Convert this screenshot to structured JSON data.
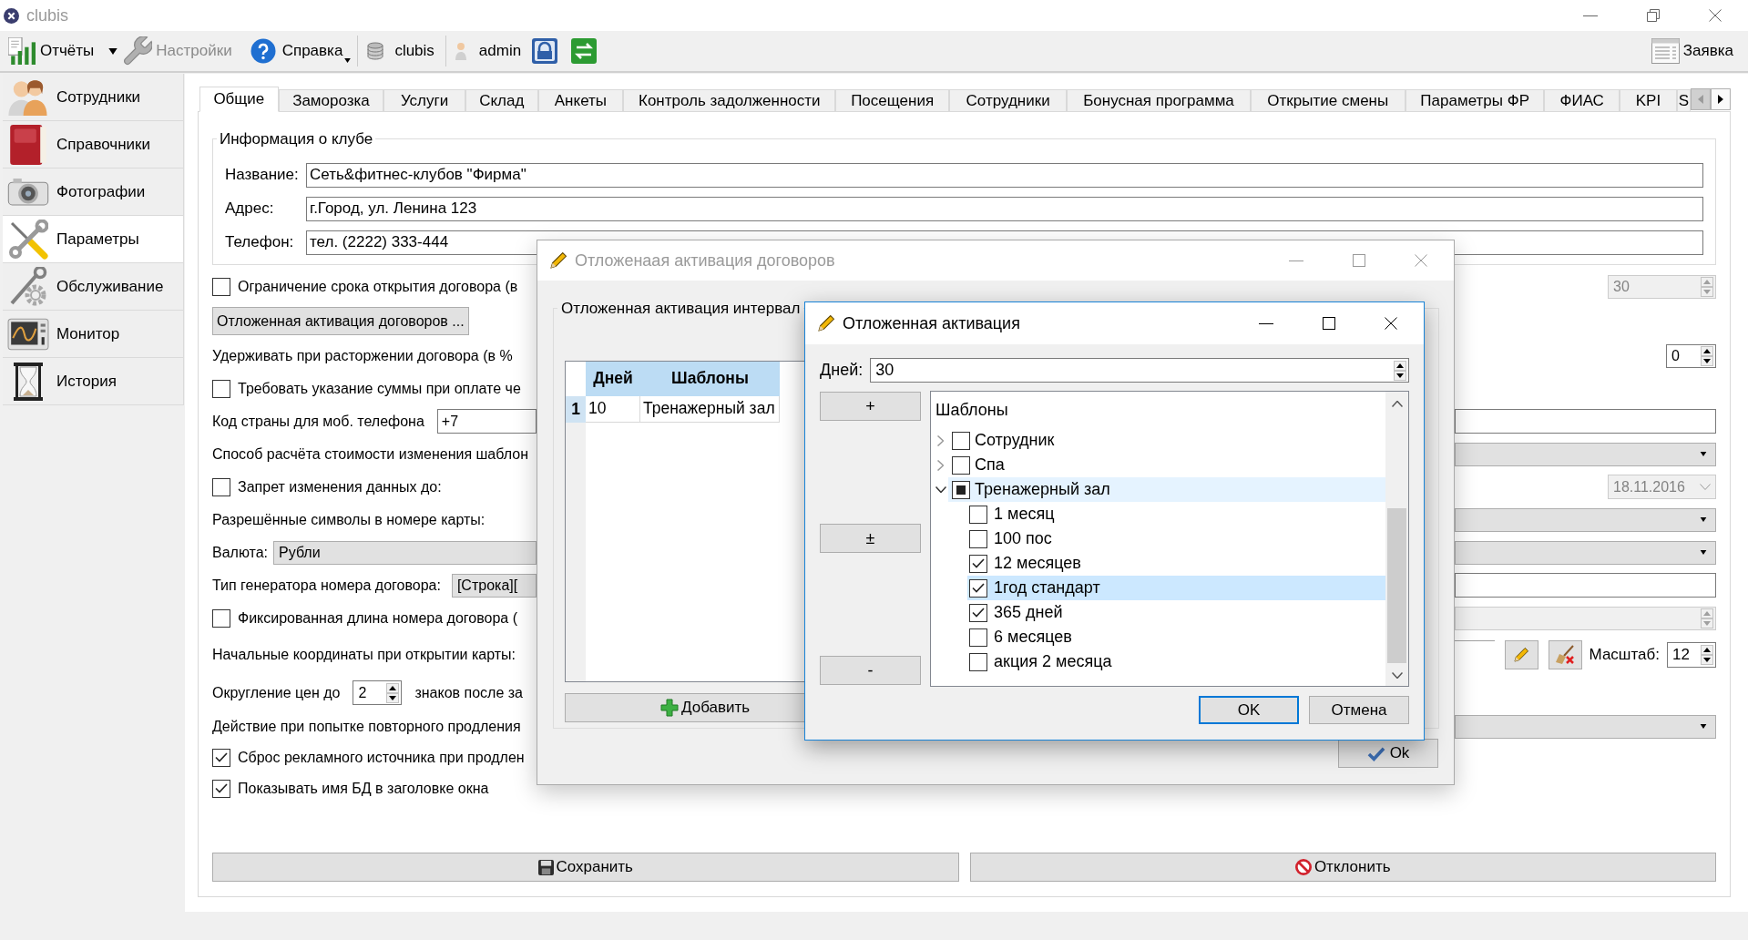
{
  "window": {
    "title": "clubis"
  },
  "toolbar": {
    "reports": {
      "label": "Отчёты",
      "disabled": false
    },
    "settings": {
      "label": "Настройки",
      "disabled": true
    },
    "help": {
      "label": "Справка",
      "disabled": false
    },
    "database": {
      "label": "clubis"
    },
    "user": {
      "label": "admin"
    },
    "request": {
      "label": "Заявка"
    }
  },
  "sidebar": {
    "items": [
      {
        "label": "Сотрудники",
        "selected": false
      },
      {
        "label": "Справочники",
        "selected": false
      },
      {
        "label": "Фотографии",
        "selected": false
      },
      {
        "label": "Параметры",
        "selected": true
      },
      {
        "label": "Обслуживание",
        "selected": false
      },
      {
        "label": "Монитор",
        "selected": false
      },
      {
        "label": "История",
        "selected": false
      }
    ]
  },
  "tabs": [
    {
      "label": "Общие",
      "selected": true
    },
    {
      "label": "Заморозка",
      "selected": false
    },
    {
      "label": "Услуги",
      "selected": false
    },
    {
      "label": "Склад",
      "selected": false
    },
    {
      "label": "Анкеты",
      "selected": false
    },
    {
      "label": "Контроль задолженности",
      "selected": false
    },
    {
      "label": "Посещения",
      "selected": false
    },
    {
      "label": "Сотрудники",
      "selected": false
    },
    {
      "label": "Бонусная программа",
      "selected": false
    },
    {
      "label": "Открытие смены",
      "selected": false
    },
    {
      "label": "Параметры ФР",
      "selected": false
    },
    {
      "label": "ФИАС",
      "selected": false
    },
    {
      "label": "KPI",
      "selected": false
    },
    {
      "label": "S",
      "selected": false
    }
  ],
  "club_info": {
    "title": "Информация о клубе",
    "fields": [
      {
        "label": "Название:",
        "value": "Сеть&фитнес-клубов \"Фирма\""
      },
      {
        "label": "Адрес:",
        "value": "г.Город, ул. Ленина 123"
      },
      {
        "label": "Телефон:",
        "value": "тел. (2222) 333-444"
      }
    ]
  },
  "settings_rows": [
    {
      "kind": "checkbox",
      "label": "Ограничение срока открытия договора (в",
      "checked": false,
      "control": {
        "kind": "spin",
        "value": "30",
        "disabled": true
      }
    },
    {
      "kind": "button",
      "label": "Отложенная активация договоров ..."
    },
    {
      "kind": "label",
      "label": "Удерживать при расторжении договора (в %",
      "control": {
        "kind": "spin",
        "value": "0",
        "disabled": false
      }
    },
    {
      "kind": "checkbox",
      "label": "Требовать указание суммы при оплате че",
      "checked": false
    },
    {
      "kind": "label",
      "label": "Код страны для моб. телефона",
      "control": {
        "kind": "field",
        "value": "+7"
      }
    },
    {
      "kind": "label",
      "label": "Способ расчёта стоимости изменения шаблон",
      "control": {
        "kind": "combo"
      }
    },
    {
      "kind": "checkbox",
      "label": "Запрет изменения данных до:",
      "checked": false,
      "control": {
        "kind": "date",
        "value": "18.11.2016",
        "disabled": true
      }
    },
    {
      "kind": "label",
      "label": "Разрешённые символы в номере карты:",
      "control": {
        "kind": "combo"
      }
    },
    {
      "kind": "label",
      "label": "Валюта:",
      "control": {
        "kind": "combo",
        "value": "Рубли"
      }
    },
    {
      "kind": "label",
      "label": "Тип генератора номера договора:",
      "control": {
        "kind": "generator",
        "value": "[Строка]["
      }
    },
    {
      "kind": "checkbox",
      "label": "Фиксированная длина номера договора (",
      "checked": false,
      "control": {
        "kind": "spin",
        "disabled": true
      }
    },
    {
      "kind": "label",
      "label": "Начальные координаты при открытии карты:",
      "control": {
        "kind": "map",
        "scale_label": "Масштаб:",
        "scale": "12"
      }
    },
    {
      "kind": "label",
      "label": "Округление цен до",
      "control": {
        "kind": "inline_spin",
        "value": "2",
        "suffix": "знаков после за"
      }
    },
    {
      "kind": "label",
      "label": "Действие при попытке повторного продления",
      "control": {
        "kind": "combo"
      }
    },
    {
      "kind": "checkbox",
      "label": "Сброс рекламного источника при продлен",
      "checked": true
    },
    {
      "kind": "checkbox",
      "label": "Показывать имя БД в заголовке окна",
      "checked": true
    }
  ],
  "actions": {
    "save": "Сохранить",
    "cancel": "Отклонить"
  },
  "outer_dialog": {
    "title": "Отложенаая активация договоров",
    "active": false,
    "group_title": "Отложенная активация интервал",
    "table": {
      "columns": [
        "Дней",
        "Шаблоны"
      ],
      "rows": [
        {
          "number": "1",
          "cells": [
            "10",
            "Тренажерный зал"
          ]
        }
      ]
    },
    "add_button": "Добавить",
    "ok_button": "Ok"
  },
  "inner_dialog": {
    "title": "Отложенная активация",
    "active": true,
    "days_label": "Дней:",
    "days": "30",
    "side_buttons": [
      "+",
      "±",
      "-"
    ],
    "tree": {
      "header": "Шаблоны",
      "items": [
        {
          "label": "Сотрудник",
          "expanded": false,
          "checked": false,
          "partial": false,
          "hovered": false,
          "selected": false
        },
        {
          "label": "Спа",
          "expanded": false,
          "checked": false,
          "partial": false,
          "hovered": false,
          "selected": false
        },
        {
          "label": "Тренажерный зал",
          "expanded": true,
          "partial": true,
          "hovered": true,
          "selected": false,
          "children": [
            {
              "label": "1 месяц",
              "checked": false,
              "selected": false
            },
            {
              "label": "100 пос",
              "checked": false,
              "selected": false
            },
            {
              "label": "12 месяцев",
              "checked": true,
              "selected": false
            },
            {
              "label": "1год стандарт",
              "checked": true,
              "selected": true
            },
            {
              "label": "365 дней",
              "checked": true,
              "selected": false
            },
            {
              "label": "6 месяцев",
              "checked": false,
              "selected": false
            },
            {
              "label": "акция 2 месяца",
              "checked": false,
              "selected": false
            }
          ]
        }
      ]
    },
    "ok": "OK",
    "cancel": "Отмена"
  }
}
